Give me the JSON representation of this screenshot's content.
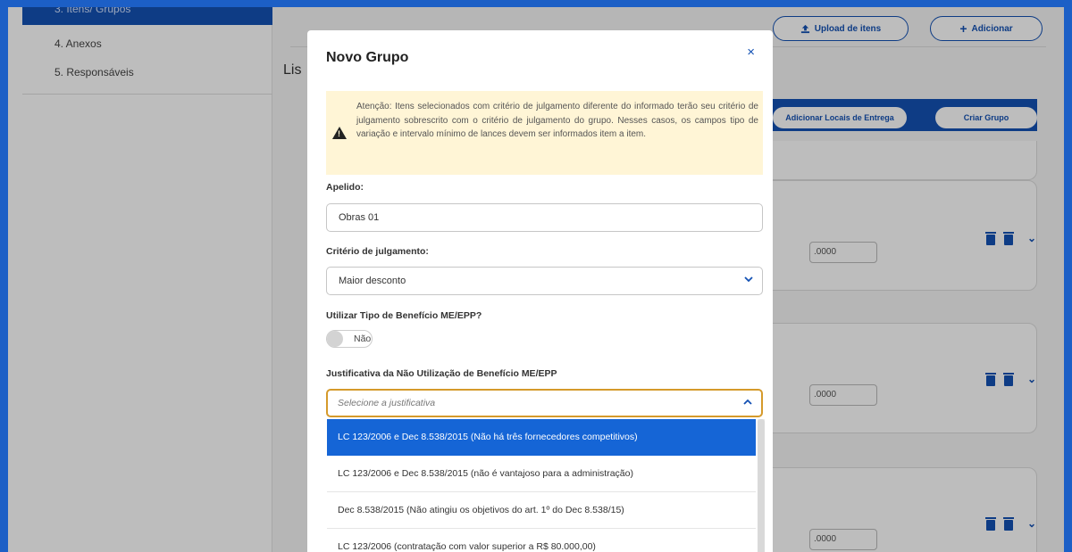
{
  "sidebar": {
    "items": [
      {
        "label": "3. Itens/ Grupos"
      },
      {
        "label": "4. Anexos"
      },
      {
        "label": "5. Responsáveis"
      }
    ]
  },
  "main": {
    "title": "Lis",
    "upload_label": "Upload de itens",
    "add_label": "Adicionar",
    "bar_buttons": [
      "Adicionar Locais de Entrega",
      "Criar Grupo"
    ],
    "card_values": [
      ".0000",
      ".0000",
      ".0000"
    ]
  },
  "modal": {
    "title": "Novo Grupo",
    "close_icon": "×",
    "alert_text": "Atenção: Itens selecionados com critério de julgamento diferente do informado terão seu critério de julgamento sobrescrito com o critério de julgamento do grupo. Nesses casos, os campos tipo de variação e intervalo mínimo de lances devem ser informados item a item.",
    "apelido_label": "Apelido:",
    "apelido_value": "Obras 01",
    "criterio_label": "Critério de julgamento:",
    "criterio_value": "Maior desconto",
    "beneficio_label": "Utilizar Tipo de Benefício ME/EPP?",
    "beneficio_toggle_label": "Não",
    "justificativa_label": "Justificativa da Não Utilização de Benefício ME/EPP",
    "justificativa_placeholder": "Selecione a justificativa",
    "options": [
      "LC 123/2006 e Dec 8.538/2015 (Não há três fornecedores competitivos)",
      "LC 123/2006 e Dec 8.538/2015 (não é vantajoso para a administração)",
      "Dec 8.538/2015 (Não atingiu os objetivos do art. 1º do Dec 8.538/15)",
      "LC 123/2006 (contratação com valor superior a R$ 80.000,00)"
    ]
  },
  "colors": {
    "primary": "#1351b4",
    "selected_option": "#1565d6",
    "alert_bg": "#fff5d6",
    "focus_border": "#d59a2b"
  }
}
